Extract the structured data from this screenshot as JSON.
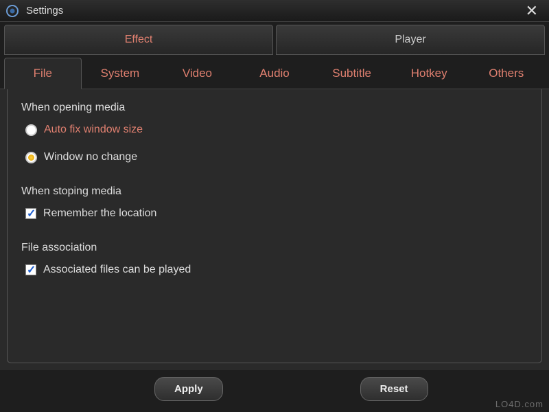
{
  "titlebar": {
    "title": "Settings"
  },
  "main_tabs": {
    "effect": "Effect",
    "player": "Player"
  },
  "sub_tabs": {
    "file": "File",
    "system": "System",
    "video": "Video",
    "audio": "Audio",
    "subtitle": "Subtitle",
    "hotkey": "Hotkey",
    "others": "Others"
  },
  "sections": {
    "opening": {
      "label": "When opening media",
      "opt_autofix": "Auto fix window size",
      "opt_nochange": "Window no change"
    },
    "stopping": {
      "label": "When stoping media",
      "opt_remember": "Remember the location"
    },
    "association": {
      "label": "File association",
      "opt_associated": "Associated files can be played"
    }
  },
  "buttons": {
    "apply": "Apply",
    "reset": "Reset"
  },
  "watermark": "LO4D.com"
}
